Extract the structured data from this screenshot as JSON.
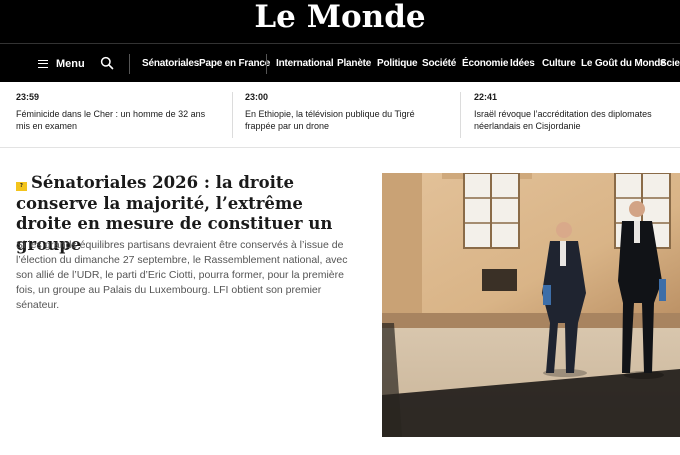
{
  "masthead": {
    "logo": "Le Monde"
  },
  "nav": {
    "menu_label": "Menu",
    "items": [
      "Sénatoriales",
      "Pape en France",
      "International",
      "Planète",
      "Politique",
      "Société",
      "Économie",
      "Idées",
      "Culture",
      "Le Goût du Monde",
      "Scien"
    ]
  },
  "ticker": [
    {
      "time": "23:59",
      "text": "Féminicide dans le Cher : un homme de 32 ans mis en examen"
    },
    {
      "time": "23:00",
      "text": "En Ethiopie, la télévision publique du Tigré frappée par un drone"
    },
    {
      "time": "22:41",
      "text": "Israël révoque l’accréditation des diplomates néerlandais en Cisjordanie"
    }
  ],
  "article": {
    "tag": "?",
    "title": "Sénatoriales 2026 : la droite conserve la majorité, l’extrême droite en mesure de constituer un groupe",
    "lede": "Si les grands équilibres partisans devraient être conservés à l’issue de l’élection du dimanche 27 septembre, le Rassemblement national, avec son allié de l’UDR, le parti d’Eric Ciotti, pourra former, pour la première fois, un groupe au Palais du Luxembourg. LFI obtient son premier sénateur."
  },
  "colors": {
    "masthead_bg": "#000000",
    "tag_yellow": "#f3c41c",
    "lede_gray": "#555555"
  }
}
